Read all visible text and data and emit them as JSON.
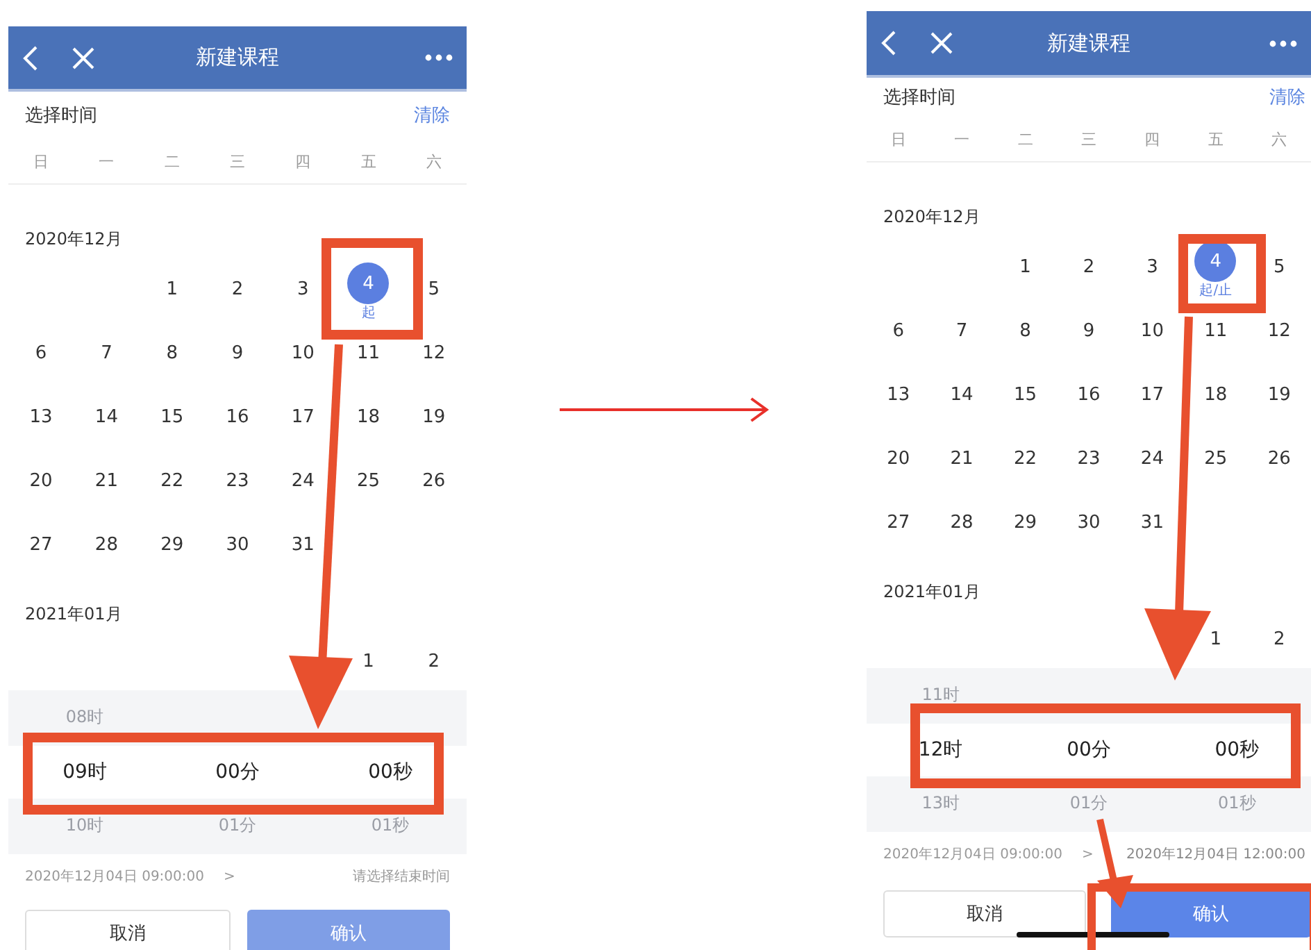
{
  "panels": [
    {
      "header": {
        "title": "新建课程"
      },
      "section_title": "选择时间",
      "clear": "清除",
      "weekdays": [
        "日",
        "一",
        "二",
        "三",
        "四",
        "五",
        "六"
      ],
      "months": [
        {
          "label": "2020年12月",
          "weeks": [
            [
              {
                "kind": "blank"
              },
              {
                "kind": "blank"
              },
              {
                "kind": "day",
                "text": "1",
                "selected": false
              },
              {
                "kind": "day",
                "text": "2",
                "selected": false
              },
              {
                "kind": "day",
                "text": "3",
                "selected": false
              },
              {
                "kind": "day",
                "text": "4",
                "selected": true,
                "tag": "起"
              },
              {
                "kind": "day",
                "text": "5",
                "selected": false
              }
            ],
            [
              {
                "kind": "day",
                "text": "6",
                "selected": false
              },
              {
                "kind": "day",
                "text": "7",
                "selected": false
              },
              {
                "kind": "day",
                "text": "8",
                "selected": false
              },
              {
                "kind": "day",
                "text": "9",
                "selected": false
              },
              {
                "kind": "day",
                "text": "10",
                "selected": false
              },
              {
                "kind": "day",
                "text": "11",
                "selected": false
              },
              {
                "kind": "day",
                "text": "12",
                "selected": false
              }
            ],
            [
              {
                "kind": "day",
                "text": "13",
                "selected": false
              },
              {
                "kind": "day",
                "text": "14",
                "selected": false
              },
              {
                "kind": "day",
                "text": "15",
                "selected": false
              },
              {
                "kind": "day",
                "text": "16",
                "selected": false
              },
              {
                "kind": "day",
                "text": "17",
                "selected": false
              },
              {
                "kind": "day",
                "text": "18",
                "selected": false
              },
              {
                "kind": "day",
                "text": "19",
                "selected": false
              }
            ],
            [
              {
                "kind": "day",
                "text": "20",
                "selected": false
              },
              {
                "kind": "day",
                "text": "21",
                "selected": false
              },
              {
                "kind": "day",
                "text": "22",
                "selected": false
              },
              {
                "kind": "day",
                "text": "23",
                "selected": false
              },
              {
                "kind": "day",
                "text": "24",
                "selected": false
              },
              {
                "kind": "day",
                "text": "25",
                "selected": false
              },
              {
                "kind": "day",
                "text": "26",
                "selected": false
              }
            ],
            [
              {
                "kind": "day",
                "text": "27",
                "selected": false
              },
              {
                "kind": "day",
                "text": "28",
                "selected": false
              },
              {
                "kind": "day",
                "text": "29",
                "selected": false
              },
              {
                "kind": "day",
                "text": "30",
                "selected": false
              },
              {
                "kind": "day",
                "text": "31",
                "selected": false
              }
            ]
          ]
        },
        {
          "label": "2021年01月",
          "weeks": [
            [
              {
                "kind": "blank"
              },
              {
                "kind": "blank"
              },
              {
                "kind": "blank"
              },
              {
                "kind": "blank"
              },
              {
                "kind": "blank"
              },
              {
                "kind": "day",
                "text": "1",
                "selected": false
              },
              {
                "kind": "day",
                "text": "2",
                "selected": false
              }
            ]
          ]
        }
      ],
      "picker": [
        {
          "above": "08时",
          "value": "09时",
          "below": "10时"
        },
        {
          "value": "00分",
          "below": "01分"
        },
        {
          "value": "00秒",
          "below": "01秒"
        }
      ],
      "summary": {
        "start": "2020年12月04日 09:00:00",
        "separator": ">",
        "end": "请选择结束时间",
        "end_set": false
      },
      "buttons": {
        "cancel": "取消",
        "confirm": "确认",
        "confirm_disabled": true
      }
    },
    {
      "header": {
        "title": "新建课程"
      },
      "section_title": "选择时间",
      "clear": "清除",
      "weekdays": [
        "日",
        "一",
        "二",
        "三",
        "四",
        "五",
        "六"
      ],
      "months": [
        {
          "label": "2020年12月",
          "weeks": [
            [
              {
                "kind": "blank"
              },
              {
                "kind": "blank"
              },
              {
                "kind": "day",
                "text": "1",
                "selected": false
              },
              {
                "kind": "day",
                "text": "2",
                "selected": false
              },
              {
                "kind": "day",
                "text": "3",
                "selected": false
              },
              {
                "kind": "day",
                "text": "4",
                "selected": true,
                "tag": "起/止"
              },
              {
                "kind": "day",
                "text": "5",
                "selected": false
              }
            ],
            [
              {
                "kind": "day",
                "text": "6",
                "selected": false
              },
              {
                "kind": "day",
                "text": "7",
                "selected": false
              },
              {
                "kind": "day",
                "text": "8",
                "selected": false
              },
              {
                "kind": "day",
                "text": "9",
                "selected": false
              },
              {
                "kind": "day",
                "text": "10",
                "selected": false
              },
              {
                "kind": "day",
                "text": "11",
                "selected": false
              },
              {
                "kind": "day",
                "text": "12",
                "selected": false
              }
            ],
            [
              {
                "kind": "day",
                "text": "13",
                "selected": false
              },
              {
                "kind": "day",
                "text": "14",
                "selected": false
              },
              {
                "kind": "day",
                "text": "15",
                "selected": false
              },
              {
                "kind": "day",
                "text": "16",
                "selected": false
              },
              {
                "kind": "day",
                "text": "17",
                "selected": false
              },
              {
                "kind": "day",
                "text": "18",
                "selected": false
              },
              {
                "kind": "day",
                "text": "19",
                "selected": false
              }
            ],
            [
              {
                "kind": "day",
                "text": "20",
                "selected": false
              },
              {
                "kind": "day",
                "text": "21",
                "selected": false
              },
              {
                "kind": "day",
                "text": "22",
                "selected": false
              },
              {
                "kind": "day",
                "text": "23",
                "selected": false
              },
              {
                "kind": "day",
                "text": "24",
                "selected": false
              },
              {
                "kind": "day",
                "text": "25",
                "selected": false
              },
              {
                "kind": "day",
                "text": "26",
                "selected": false
              }
            ],
            [
              {
                "kind": "day",
                "text": "27",
                "selected": false
              },
              {
                "kind": "day",
                "text": "28",
                "selected": false
              },
              {
                "kind": "day",
                "text": "29",
                "selected": false
              },
              {
                "kind": "day",
                "text": "30",
                "selected": false
              },
              {
                "kind": "day",
                "text": "31",
                "selected": false
              }
            ]
          ]
        },
        {
          "label": "2021年01月",
          "weeks": [
            [
              {
                "kind": "blank"
              },
              {
                "kind": "blank"
              },
              {
                "kind": "blank"
              },
              {
                "kind": "blank"
              },
              {
                "kind": "blank"
              },
              {
                "kind": "day",
                "text": "1",
                "selected": false
              },
              {
                "kind": "day",
                "text": "2",
                "selected": false
              }
            ]
          ]
        }
      ],
      "picker": [
        {
          "above": "11时",
          "value": "12时",
          "below": "13时"
        },
        {
          "value": "00分",
          "below": "01分"
        },
        {
          "value": "00秒",
          "below": "01秒"
        }
      ],
      "summary": {
        "start": "2020年12月04日 09:00:00",
        "separator": ">",
        "end": "2020年12月04日 12:00:00",
        "end_set": true
      },
      "buttons": {
        "cancel": "取消",
        "confirm": "确认",
        "confirm_disabled": false
      }
    }
  ]
}
